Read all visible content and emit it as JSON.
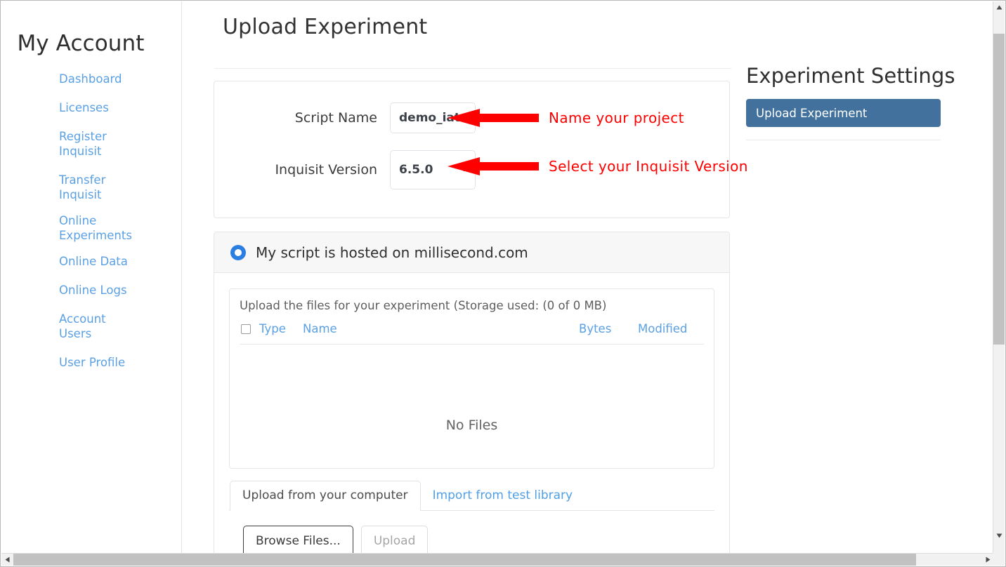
{
  "sidebar": {
    "title": "My Account",
    "items": [
      {
        "label": "Dashboard"
      },
      {
        "label": "Licenses"
      },
      {
        "label": "Register Inquisit"
      },
      {
        "label": "Transfer Inquisit"
      },
      {
        "label": "Online Experiments"
      },
      {
        "label": "Online Data"
      },
      {
        "label": "Online Logs"
      },
      {
        "label": "Account Users"
      },
      {
        "label": "User Profile"
      }
    ]
  },
  "main": {
    "page_title": "Upload Experiment",
    "form": {
      "script_name_label": "Script Name",
      "script_name_value": "demo_iat",
      "script_name_placeholder": "Script Name",
      "version_label": "Inquisit Version",
      "version_value": "6.5.0",
      "version_options": [
        "6.5.0"
      ]
    },
    "annotations": [
      {
        "text": "Name your project",
        "color": "#ff0000"
      },
      {
        "text": "Select your Inquisit Version",
        "color": "#ff0000"
      }
    ],
    "hosted": {
      "radio_label": "My script is hosted on millisecond.com",
      "radio_selected": true,
      "radio_color": "#2b7fe0"
    },
    "files": {
      "storage_line": "Upload the files for your experiment (Storage used: (0 of 0 MB)",
      "columns": [
        "Type",
        "Name",
        "Bytes",
        "Modified"
      ],
      "rows": [],
      "empty_text": "No Files"
    },
    "tabs": [
      {
        "label": "Upload from your computer",
        "active": true
      },
      {
        "label": "Import from test library",
        "active": false
      }
    ],
    "buttons": {
      "browse_label": "Browse Files...",
      "upload_label": "Upload"
    }
  },
  "right_panel": {
    "title": "Experiment Settings",
    "upload_experiment_label": "Upload Experiment",
    "accent_color": "#41719c"
  }
}
